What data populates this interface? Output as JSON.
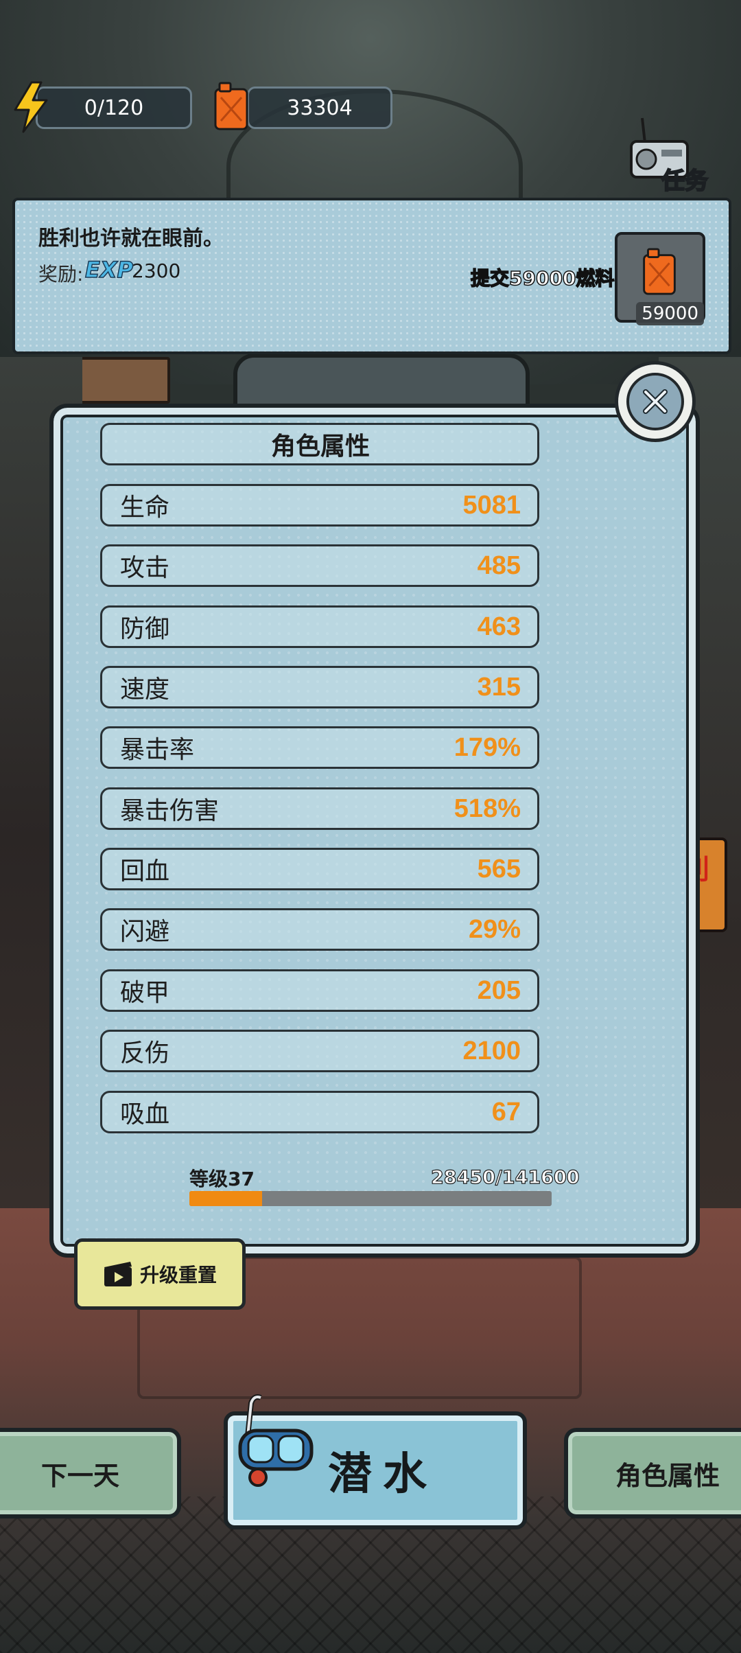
{
  "resources": {
    "energy": "0/120",
    "fuel": "33304"
  },
  "task_button": {
    "label": "任务"
  },
  "quest": {
    "text": "胜利也许就在眼前。",
    "reward_label": "奖励:",
    "reward_type": "EXP",
    "reward_amount": "2300",
    "submit_label": "提交59000燃料",
    "item_count": "59000"
  },
  "panel": {
    "title": "角色属性",
    "stats": [
      {
        "label": "生命",
        "value": "5081"
      },
      {
        "label": "攻击",
        "value": "485"
      },
      {
        "label": "防御",
        "value": "463"
      },
      {
        "label": "速度",
        "value": "315"
      },
      {
        "label": "暴击率",
        "value": "179%"
      },
      {
        "label": "暴击伤害",
        "value": "518%"
      },
      {
        "label": "回血",
        "value": "565"
      },
      {
        "label": "闪避",
        "value": "29%"
      },
      {
        "label": "破甲",
        "value": "205"
      },
      {
        "label": "反伤",
        "value": "2100"
      },
      {
        "label": "吸血",
        "value": "67"
      }
    ],
    "level": "等级37",
    "exp_text": "28450/141600",
    "exp_progress": 0.2009
  },
  "reset_button": {
    "label": "升级重置"
  },
  "bottom": {
    "next_day": "下一天",
    "dive": "潜水",
    "attributes": "角色属性"
  },
  "colors": {
    "stat_value": "#f0901a",
    "panel_bg": "#a9cbd8",
    "exp_fill": "#f08a12"
  },
  "icons": [
    "lightning-icon",
    "fuel-can-icon",
    "radio-icon",
    "close-icon",
    "video-icon",
    "diving-mask-icon"
  ]
}
